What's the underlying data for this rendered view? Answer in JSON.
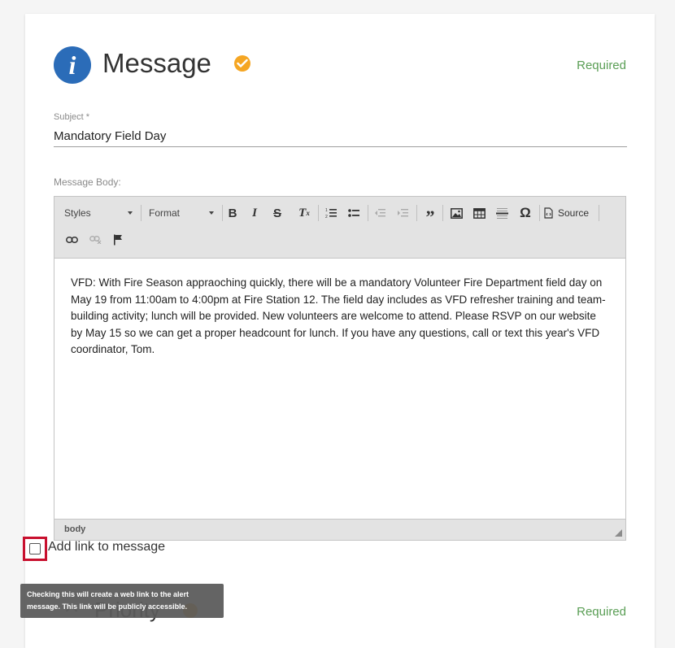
{
  "section": {
    "title": "Message",
    "required_label": "Required",
    "next_required_label": "Required",
    "next_title": "Priority",
    "accent_color": "#f5a623",
    "info_icon_glyph": "i"
  },
  "subject": {
    "label": "Subject *",
    "value": "Mandatory Field Day"
  },
  "body": {
    "label": "Message Body:",
    "toolbar": {
      "styles_label": "Styles",
      "format_label": "Format",
      "source_label": "Source"
    },
    "text": "VFD: With Fire Season appraoching quickly, there will be a mandatory Volunteer Fire Department field day on May 19 from 11:00am to 4:00pm at Fire Station 12. The field day includes as VFD refresher training and team-building activity; lunch will be provided. New volunteers are welcome to attend. Please RSVP on our website by May 15 so we can get a proper headcount for lunch. If you have any questions, call or text this year's VFD coordinator, Tom.",
    "status_path": "body"
  },
  "link_option": {
    "label": "Add link to message",
    "checked": false,
    "tooltip": "Checking this will create a web link to the alert message. This link will be publicly accessible."
  }
}
